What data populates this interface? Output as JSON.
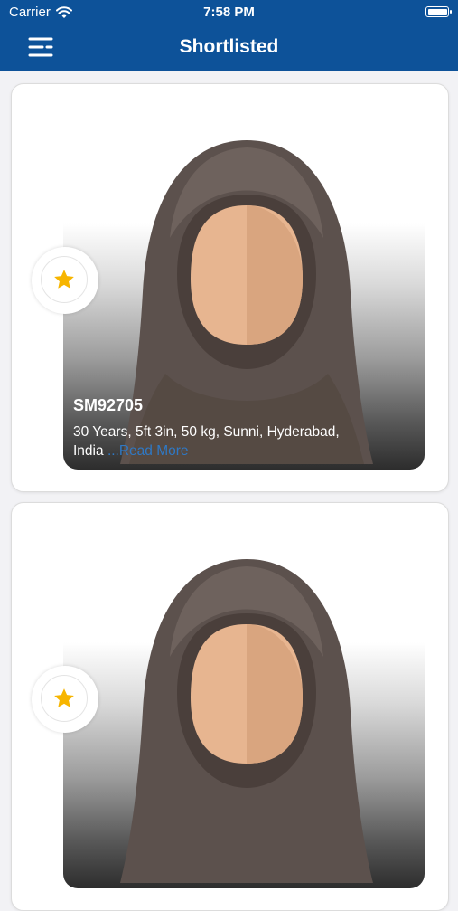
{
  "status_bar": {
    "carrier": "Carrier",
    "time": "7:58 PM",
    "battery_level": 1.0
  },
  "header": {
    "title": "Shortlisted",
    "menu_icon": "menu-icon"
  },
  "profiles": [
    {
      "id": "SM92705",
      "details": "30 Years, 5ft 3in, 50 kg, Sunni, Hyderabad, India",
      "read_more": "...Read More",
      "shortlisted": true
    },
    {
      "id": "",
      "details": "",
      "read_more": "",
      "shortlisted": true
    }
  ],
  "colors": {
    "header": "#0d5299",
    "star": "#f7b500",
    "read_more": "#2f78c4"
  }
}
